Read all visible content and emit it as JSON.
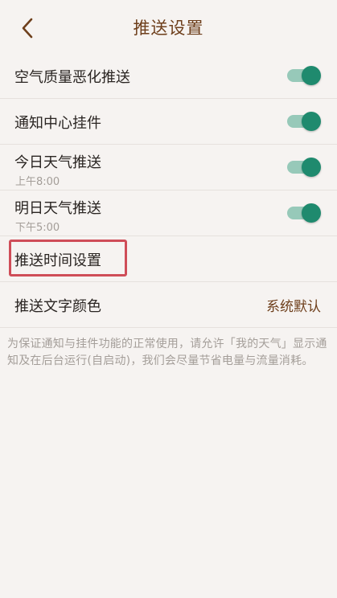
{
  "header": {
    "back_icon": "chevron-left-icon",
    "title": "推送设置"
  },
  "colors": {
    "accent": "#6e3f1c",
    "toggle_on": "#1f8a6e",
    "toggle_track": "#97c9b9",
    "highlight": "#cf4d58",
    "background": "#f6f3f1"
  },
  "settings": {
    "air_quality": {
      "label": "空气质量恶化推送",
      "enabled": true
    },
    "notification_widget": {
      "label": "通知中心挂件",
      "enabled": true
    },
    "today_weather": {
      "label": "今日天气推送",
      "time": "上午8:00",
      "enabled": true
    },
    "tomorrow_weather": {
      "label": "明日天气推送",
      "time": "下午5:00",
      "enabled": true
    },
    "push_time": {
      "label": "推送时间设置"
    },
    "text_color": {
      "label": "推送文字颜色",
      "value": "系统默认"
    }
  },
  "footnote": "为保证通知与挂件功能的正常使用，请允许「我的天气」显示通知及在后台运行(自启动)，我们会尽量节省电量与流量消耗。"
}
